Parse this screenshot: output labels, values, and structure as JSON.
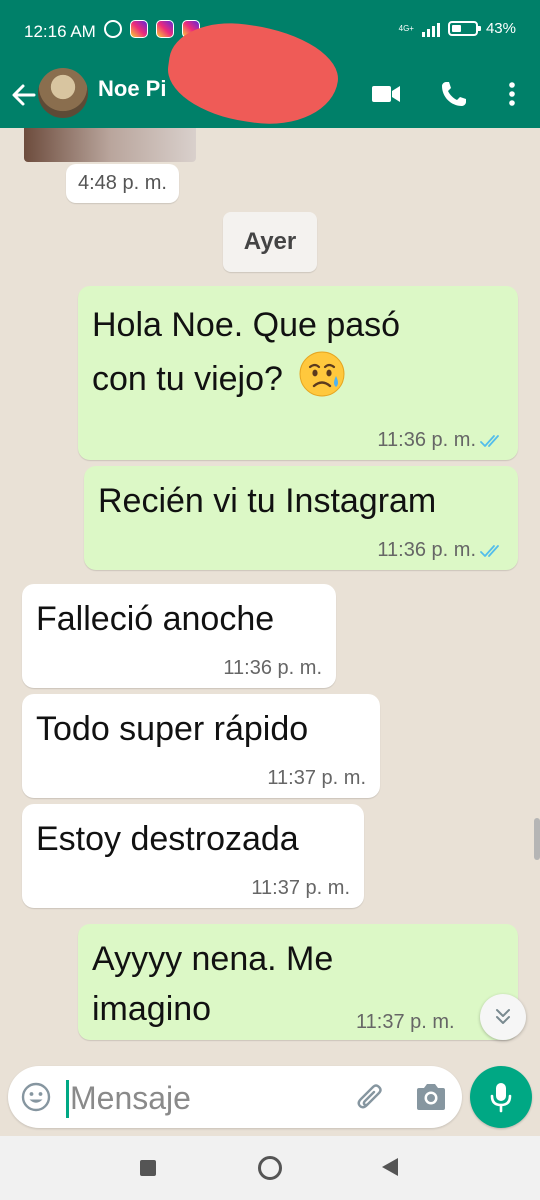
{
  "status_bar": {
    "time": "12:16 AM",
    "network": "4G+",
    "battery": "43%",
    "battery_level": 0.43,
    "more": "···"
  },
  "header": {
    "contact_name": "Noe Pi"
  },
  "media_message": {
    "time": "4:48 p. m."
  },
  "date_divider": "Ayer",
  "messages": [
    {
      "direction": "outgoing",
      "line1": "Hola Noe. Que pasó",
      "line2": "con tu viejo?",
      "emoji": "sad-but-relieved-face",
      "time": "11:36 p. m.",
      "status": "read"
    },
    {
      "direction": "outgoing",
      "line1": "Recién vi tu Instagram",
      "time": "11:36 p. m.",
      "status": "read"
    },
    {
      "direction": "incoming",
      "line1": "Falleció anoche",
      "time": "11:36 p. m."
    },
    {
      "direction": "incoming",
      "line1": "Todo super rápido",
      "time": "11:37 p. m."
    },
    {
      "direction": "incoming",
      "line1": "Estoy destrozada",
      "time": "11:37 p. m."
    },
    {
      "direction": "outgoing",
      "line1": "Ayyyy nena. Me",
      "line2": "imagino",
      "time": "11:37 p. m."
    }
  ],
  "composer": {
    "placeholder": "Mensaje"
  },
  "colors": {
    "header": "#008069",
    "outgoing_bubble": "#dcf8c6",
    "incoming_bubble": "#ffffff",
    "accent": "#00a884",
    "read_ticks": "#53bdeb"
  }
}
